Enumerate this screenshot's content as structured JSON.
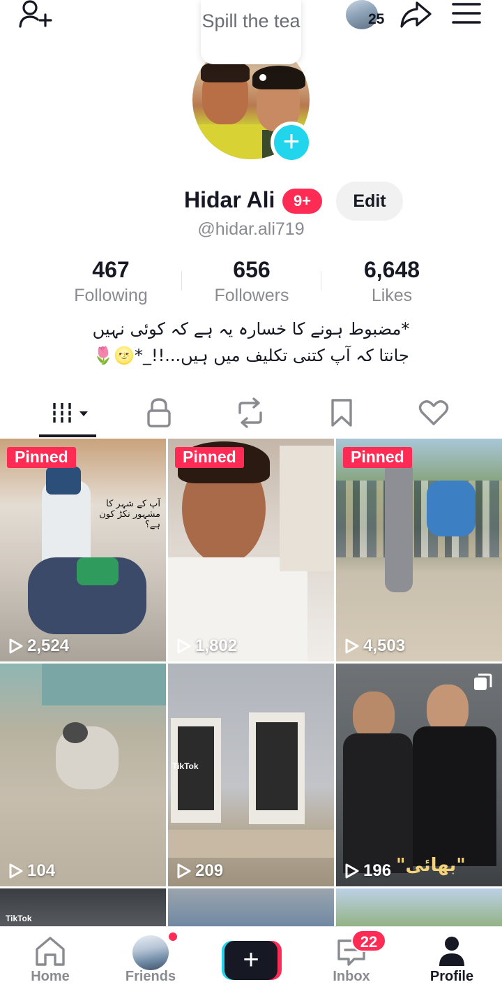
{
  "header": {
    "friends_count": "25",
    "tooltip": "Spill the tea"
  },
  "profile": {
    "name": "Hidar Ali",
    "notification_badge": "9+",
    "edit_label": "Edit",
    "handle": "@hidar.ali719",
    "stats": [
      {
        "value": "467",
        "label": "Following"
      },
      {
        "value": "656",
        "label": "Followers"
      },
      {
        "value": "6,648",
        "label": "Likes"
      }
    ],
    "bio_line1": "*مضبوط ہونے کا خسارہ یہ ہے کہ کوئی نہیں",
    "bio_line2": "جانتا کہ آپ کتنی تکلیف میں ہیں...!!_*🌝🌷"
  },
  "tabs": [
    {
      "icon": "videos-grid-icon"
    },
    {
      "icon": "lock-icon"
    },
    {
      "icon": "repost-icon"
    },
    {
      "icon": "bookmark-icon"
    },
    {
      "icon": "heart-icon"
    }
  ],
  "videos": [
    {
      "pinned": "Pinned",
      "views": "2,524",
      "caption": "آپ کے شہر کا مشہور نکڑ کون ہے؟"
    },
    {
      "pinned": "Pinned",
      "views": "1,802"
    },
    {
      "pinned": "Pinned",
      "views": "4,503"
    },
    {
      "views": "104"
    },
    {
      "views": "209",
      "watermark": "TikTok"
    },
    {
      "views": "196",
      "caption": "\"بھائی\""
    }
  ],
  "bottom_nav": {
    "home": "Home",
    "friends": "Friends",
    "inbox": "Inbox",
    "inbox_badge": "22",
    "profile": "Profile"
  },
  "row3_watermark": "TikTok",
  "colors": {
    "accent_red": "#fe2c55",
    "accent_cyan": "#20d5ec",
    "text_primary": "#161823",
    "text_secondary": "#8a8b91"
  }
}
